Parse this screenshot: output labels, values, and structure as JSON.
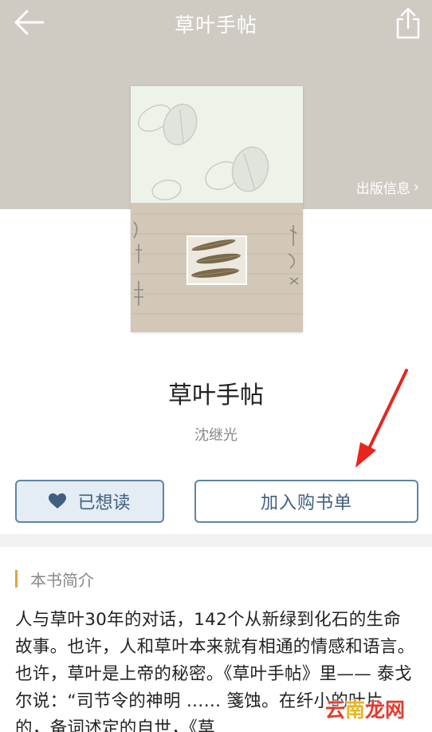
{
  "nav": {
    "title": "草叶手帖"
  },
  "publish_info_label": "出版信息",
  "book": {
    "title": "草叶手帖",
    "author": "沈继光"
  },
  "buttons": {
    "want_read_label": "已想读",
    "add_cart_label": "加入购书单"
  },
  "intro_section": {
    "title": "本书简介",
    "text": "人与草叶30年的对话，142个从新绿到化石的生命故事。也许，人和草叶本来就有相通的情感和语言。也许，草叶是上帝的秘密。《草叶手帖》里—— 泰戈尔说：“司节令的神明 ……  箋蚀。在纤小的叶片的，备词述定的自世，《草"
  },
  "watermark": {
    "part1": "云",
    "part2": "南",
    "part3": "龙网"
  },
  "colors": {
    "hero_bg": "#cfcbc3",
    "accent_blue": "#5f84a8",
    "section_bar": "#e0a24a",
    "annotation_arrow": "#e8251e"
  }
}
